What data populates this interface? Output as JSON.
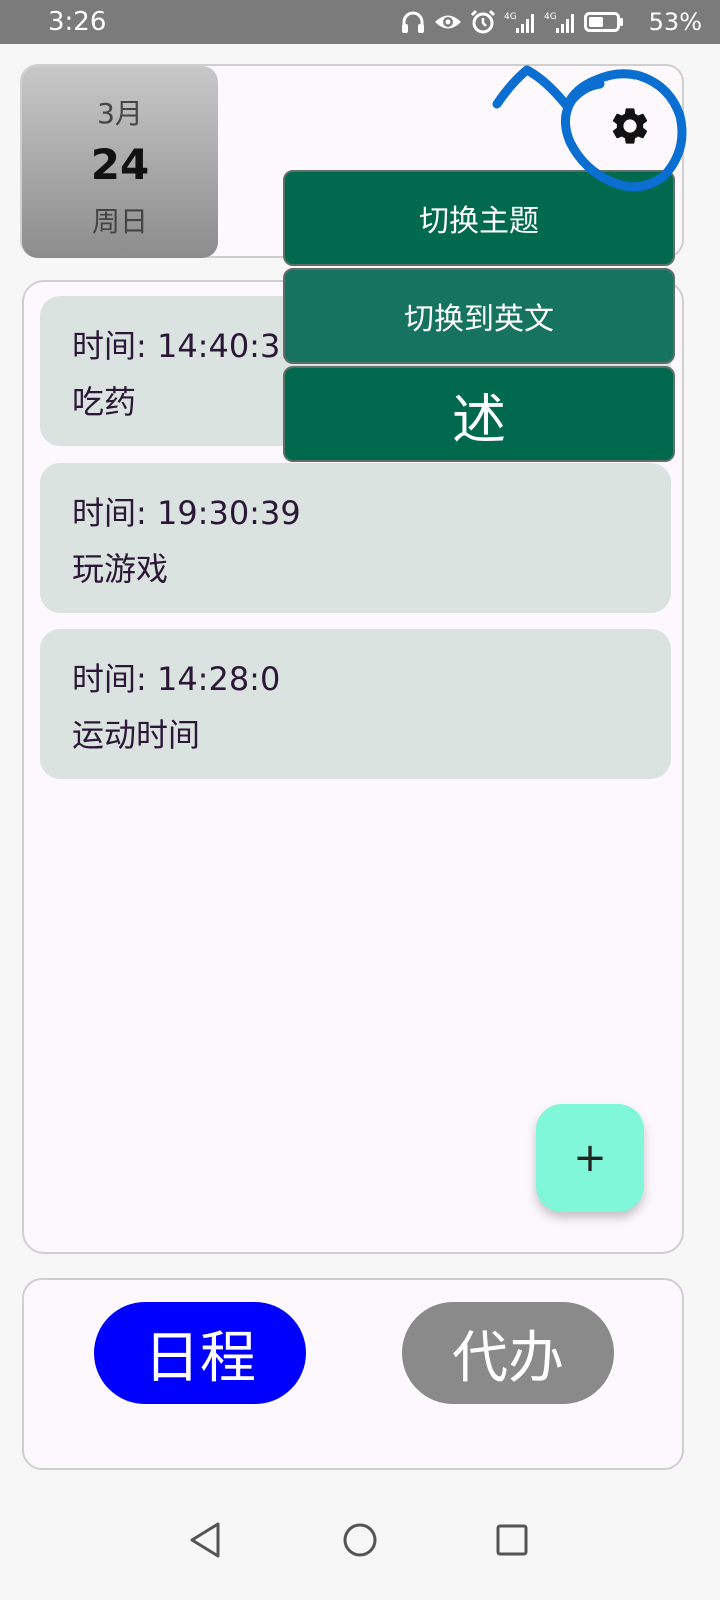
{
  "status_bar": {
    "time": "3:26",
    "battery_percent": "53%",
    "icons": [
      "headphones-icon",
      "eye-icon",
      "alarm-icon",
      "signal-4g-icon",
      "signal-4g-icon",
      "battery-icon"
    ]
  },
  "header": {
    "month": "3月",
    "day": "24",
    "weekday": "周日",
    "settings_icon": "gear-icon"
  },
  "menu": {
    "items": [
      {
        "label": "切换主题"
      },
      {
        "label": "切换到英文"
      },
      {
        "label": "述"
      }
    ]
  },
  "schedule": {
    "items": [
      {
        "time": "时间: 14:40:3",
        "title": "吃药"
      },
      {
        "time": "时间: 19:30:39",
        "title": "玩游戏"
      },
      {
        "time": "时间: 14:28:0",
        "title": "运动时间"
      }
    ],
    "add_button_label": "+"
  },
  "tabs": [
    {
      "label": "日程",
      "active": true
    },
    {
      "label": "代办",
      "active": false
    }
  ],
  "nav": {
    "icons": [
      "back-icon",
      "home-icon",
      "recents-icon"
    ]
  },
  "colors": {
    "menu_green": "#00694e",
    "card_bg": "#dae3df",
    "fab_bg": "#7ff7d8",
    "tab_active": "#0000ff",
    "tab_inactive": "#8a8a8a",
    "annotation_blue": "#0a6fd1"
  }
}
